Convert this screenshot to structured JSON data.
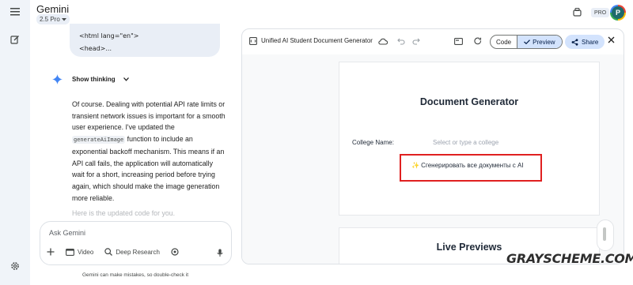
{
  "app": {
    "title": "Gemini",
    "model": "2.5 Pro"
  },
  "header": {
    "pro_badge": "PRO",
    "avatar_initial": "P"
  },
  "chat": {
    "user_code_lines": [
      "<html lang=\"en\">",
      "<head>..."
    ],
    "thinking_label": "Show thinking",
    "answer_before_code": "Of course. Dealing with potential API rate limits or transient network issues is important for a smooth user experience. I've updated the",
    "answer_code": "generateAiImage",
    "answer_after_code": "function to include an exponential backoff mechanism. This means if an API call fails, the application will automatically wait for a short, increasing period before trying again, which should make the image generation more reliable.",
    "faded_line": "Here is the updated code for you."
  },
  "input": {
    "placeholder": "Ask Gemini",
    "tools": {
      "video": "Video",
      "deep_research": "Deep Research"
    },
    "disclaimer": "Gemini can make mistakes, so double-check it"
  },
  "panel": {
    "title": "Unified AI Student Document Generator",
    "code_tab": "Code",
    "preview_tab": "Preview",
    "share_label": "Share"
  },
  "preview": {
    "heading": "Document Generator",
    "college_label": "College Name:",
    "college_placeholder": "Select or type a college",
    "generate_button": "✨ Сгенерировать все документы с AI",
    "live_previews_heading": "Live Previews"
  },
  "watermark": "GRAYSCHEME.COM",
  "colors": {
    "accent": "#d3e3fd",
    "highlight_box": "#e02020",
    "rail_bg": "#f0f4f9",
    "gem_blue": "#4285f4"
  },
  "icons": [
    "menu-icon",
    "new-chat-icon",
    "settings-icon",
    "chevron-down-icon",
    "gemini-sparkle-icon",
    "plus-icon",
    "video-icon",
    "deep-research-icon",
    "canvas-icon",
    "mic-icon",
    "code-file-icon",
    "cloud-icon",
    "undo-icon",
    "redo-icon",
    "display-icon",
    "refresh-icon",
    "check-icon",
    "share-icon",
    "close-icon",
    "archive-icon"
  ]
}
